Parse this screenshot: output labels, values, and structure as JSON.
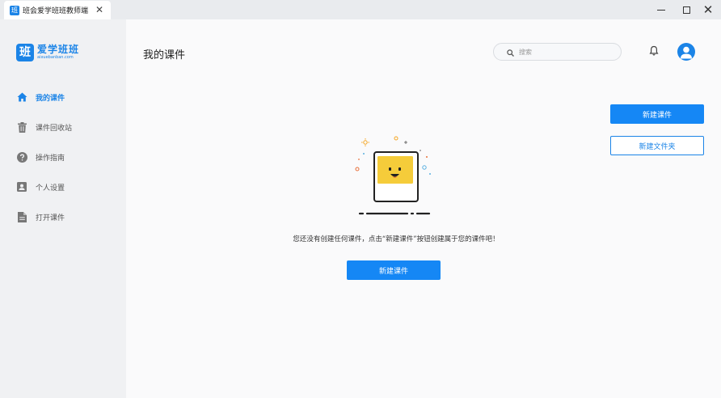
{
  "window": {
    "tab_icon_text": "班",
    "tab_title": "班会爱学班班教师端",
    "tab_close": "✕",
    "close_glyph": "✕"
  },
  "sidebar": {
    "logo_mark": "班",
    "logo_name": "爱学班班",
    "logo_sub": "aixuebanban.com",
    "items": [
      {
        "label": "我的课件",
        "icon": "home-icon",
        "active": true
      },
      {
        "label": "课件回收站",
        "icon": "trash-icon",
        "active": false
      },
      {
        "label": "操作指南",
        "icon": "help-icon",
        "active": false
      },
      {
        "label": "个人设置",
        "icon": "user-card-icon",
        "active": false
      },
      {
        "label": "打开课件",
        "icon": "file-icon",
        "active": false
      }
    ]
  },
  "header": {
    "title": "我的课件",
    "search_placeholder": "搜索"
  },
  "actions": {
    "new_course": "新建课件",
    "new_folder": "新建文件夹"
  },
  "empty_state": {
    "message": "您还没有创建任何课件，点击“新建课件”按钮创建属于您的课件吧！",
    "button": "新建课件"
  },
  "colors": {
    "accent": "#1587f5",
    "sidebar_bg": "#f0f1f3",
    "face_yellow": "#f5cc3a"
  }
}
